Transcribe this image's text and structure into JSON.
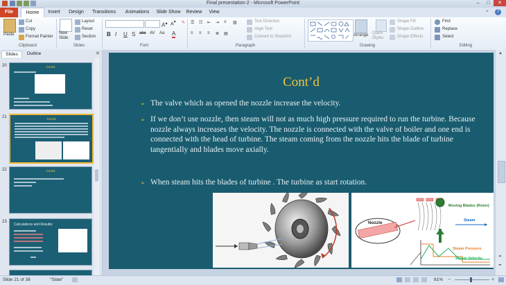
{
  "window": {
    "title": "Final presentation-2 - Microsoft PowerPoint",
    "controls": [
      "–",
      "□",
      "✕"
    ]
  },
  "tabs": [
    "File",
    "Home",
    "Insert",
    "Design",
    "Transitions",
    "Animations",
    "Slide Show",
    "Review",
    "View"
  ],
  "ribbon": {
    "clipboard": {
      "paste": "Paste",
      "cut": "Cut",
      "copy": "Copy",
      "format_painter": "Format Painter",
      "label": "Clipboard"
    },
    "slides": {
      "new_slide": "New Slide",
      "layout": "Layout",
      "reset": "Reset",
      "section": "Section",
      "label": "Slides"
    },
    "font": {
      "label": "Font",
      "bold": "B",
      "italic": "I",
      "underline": "U",
      "strike": "S",
      "shadow": "abc",
      "aa": "Aa"
    },
    "paragraph": {
      "label": "Paragraph",
      "text_direction": "Text Direction",
      "align_text": "Align Text",
      "convert_smartart": "Convert to SmartArt"
    },
    "drawing": {
      "label": "Drawing",
      "arrange": "Arrange",
      "quick_styles": "Quick Styles",
      "shape_fill": "Shape Fill",
      "shape_outline": "Shape Outline",
      "shape_effects": "Shape Effects"
    },
    "editing": {
      "label": "Editing",
      "find": "Find",
      "replace": "Replace",
      "select": "Select"
    }
  },
  "left_pane": {
    "tabs": [
      "Slides",
      "Outline"
    ],
    "thumbnails": [
      {
        "num": "20",
        "title": "Cont'd"
      },
      {
        "num": "21",
        "title": "Cont'd"
      },
      {
        "num": "22",
        "title": "Cont'd"
      },
      {
        "num": "23",
        "title": "Calculations and Results:"
      }
    ]
  },
  "slide": {
    "title": "Cont’d",
    "bullets": [
      "The valve which as opened the nozzle increase the velocity.",
      "If we don’t use nozzle, then steam will not as much high pressure required to run the turbine. Because nozzle always increases the velocity. The nozzle is connected with the valve of boiler and one end is connected with the head of turbine. The steam coming from the nozzle hits the blade of turbine tangentially and blades move axially.",
      "When steam hits the blades of turbine . The turbine as start rotation."
    ],
    "diagram_labels": {
      "nozzle": "Nozzle",
      "moving_blades": "Moving Blades (Rotor)",
      "steam": "Steam",
      "steam_pressure": "Steam Pressure",
      "steam_velocity": "Steam Velocity"
    }
  },
  "status": {
    "slide": "Slide 21 of 38",
    "theme": "\"Slate\"",
    "zoom": "81%"
  }
}
